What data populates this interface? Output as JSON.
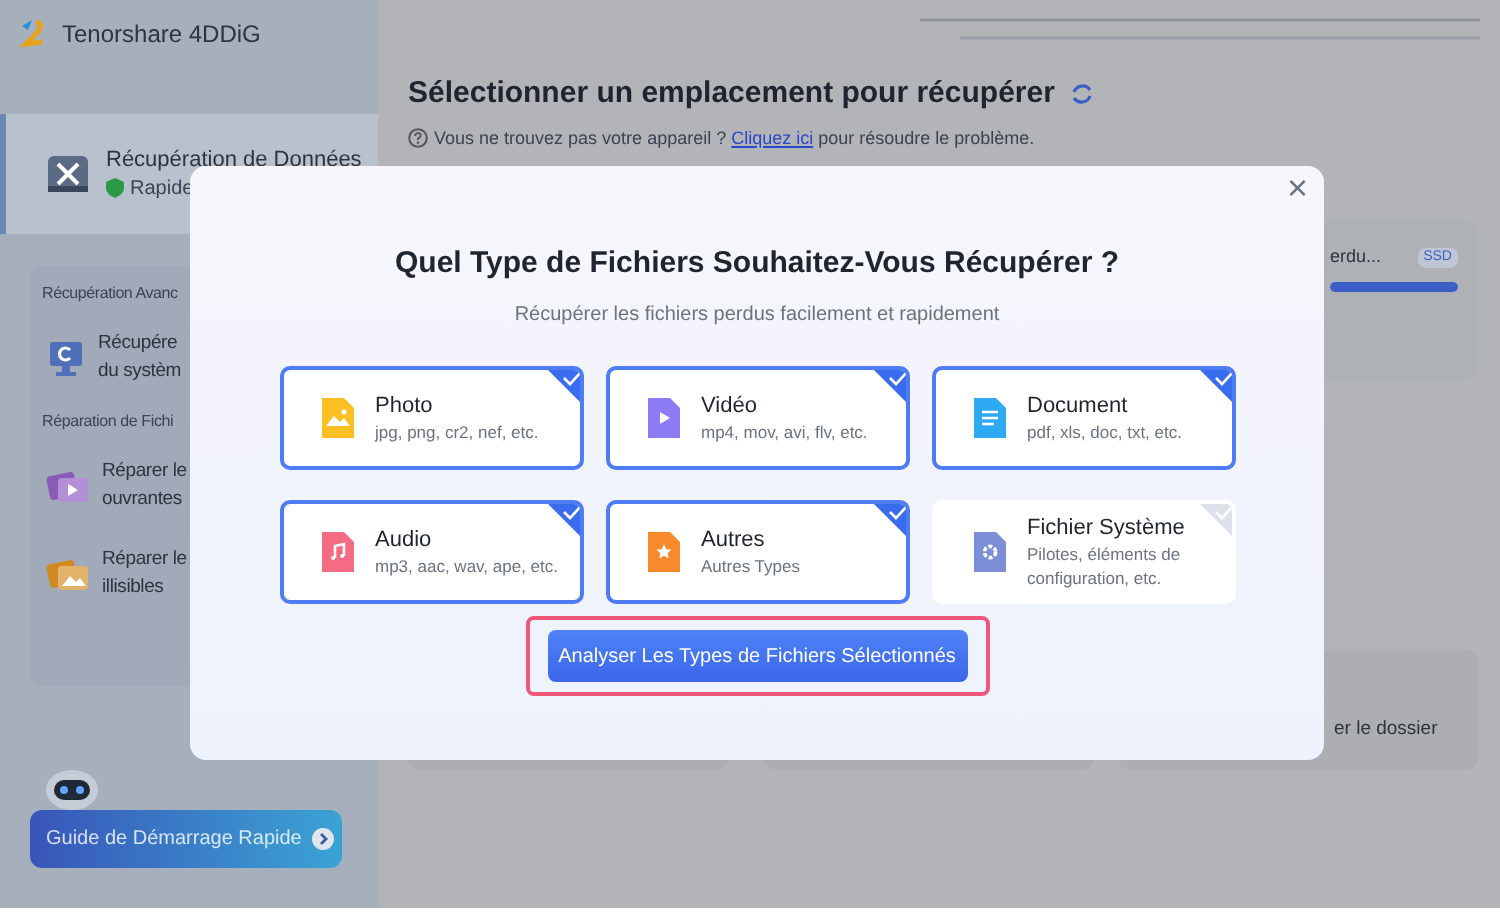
{
  "app": {
    "title": "Tenorshare 4DDiG"
  },
  "sidebar": {
    "active_item": {
      "title": "Récupération de Données",
      "subtitle": "Rapide",
      "selected": true
    },
    "sections": [
      {
        "heading": "Récupération Avanc",
        "items": [
          {
            "kind": "system",
            "lines": [
              "Récupére",
              "du systèm"
            ]
          }
        ]
      },
      {
        "heading": "Réparation de Fichi",
        "items": [
          {
            "kind": "video-repair",
            "lines": [
              "Réparer le",
              "ouvrantes"
            ]
          },
          {
            "kind": "photo-repair",
            "lines": [
              "Réparer le",
              "illisibles"
            ]
          }
        ]
      }
    ],
    "guide_button": "Guide de Démarrage Rapide"
  },
  "main": {
    "title": "Sélectionner un emplacement pour récupérer",
    "help": {
      "text": "Vous ne trouvez pas votre appareil ?",
      "link": "Cliquez ici",
      "rest": "pour résoudre le problème."
    },
    "drive_card": {
      "name": "erdu...",
      "badge": "SSD",
      "level": 1
    },
    "folder_card": {
      "text": "er le dossier"
    }
  },
  "dialog": {
    "title": "Quel Type de Fichiers Souhaitez-Vous Récupérer ?",
    "subtitle": "Récupérer les fichiers perdus facilement et rapidement",
    "file_types": [
      {
        "kind": "photo",
        "name": "Photo",
        "description": "jpg, png, cr2, nef, etc.",
        "checked": true
      },
      {
        "kind": "video",
        "name": "Vidéo",
        "description": "mp4, mov, avi, flv, etc.",
        "checked": true
      },
      {
        "kind": "document",
        "name": "Document",
        "description": "pdf, xls, doc, txt, etc.",
        "checked": true
      },
      {
        "kind": "audio",
        "name": "Audio",
        "description": "mp3, aac, wav, ape, etc.",
        "checked": true
      },
      {
        "kind": "other",
        "name": "Autres",
        "description": "Autres Types",
        "checked": true
      },
      {
        "kind": "system",
        "name": "Fichier Système",
        "description": "Pilotes, éléments de configuration, etc.",
        "checked": false
      }
    ],
    "scan_button": "Analyser Les Types de Fichiers Sélectionnés",
    "close": "×"
  }
}
